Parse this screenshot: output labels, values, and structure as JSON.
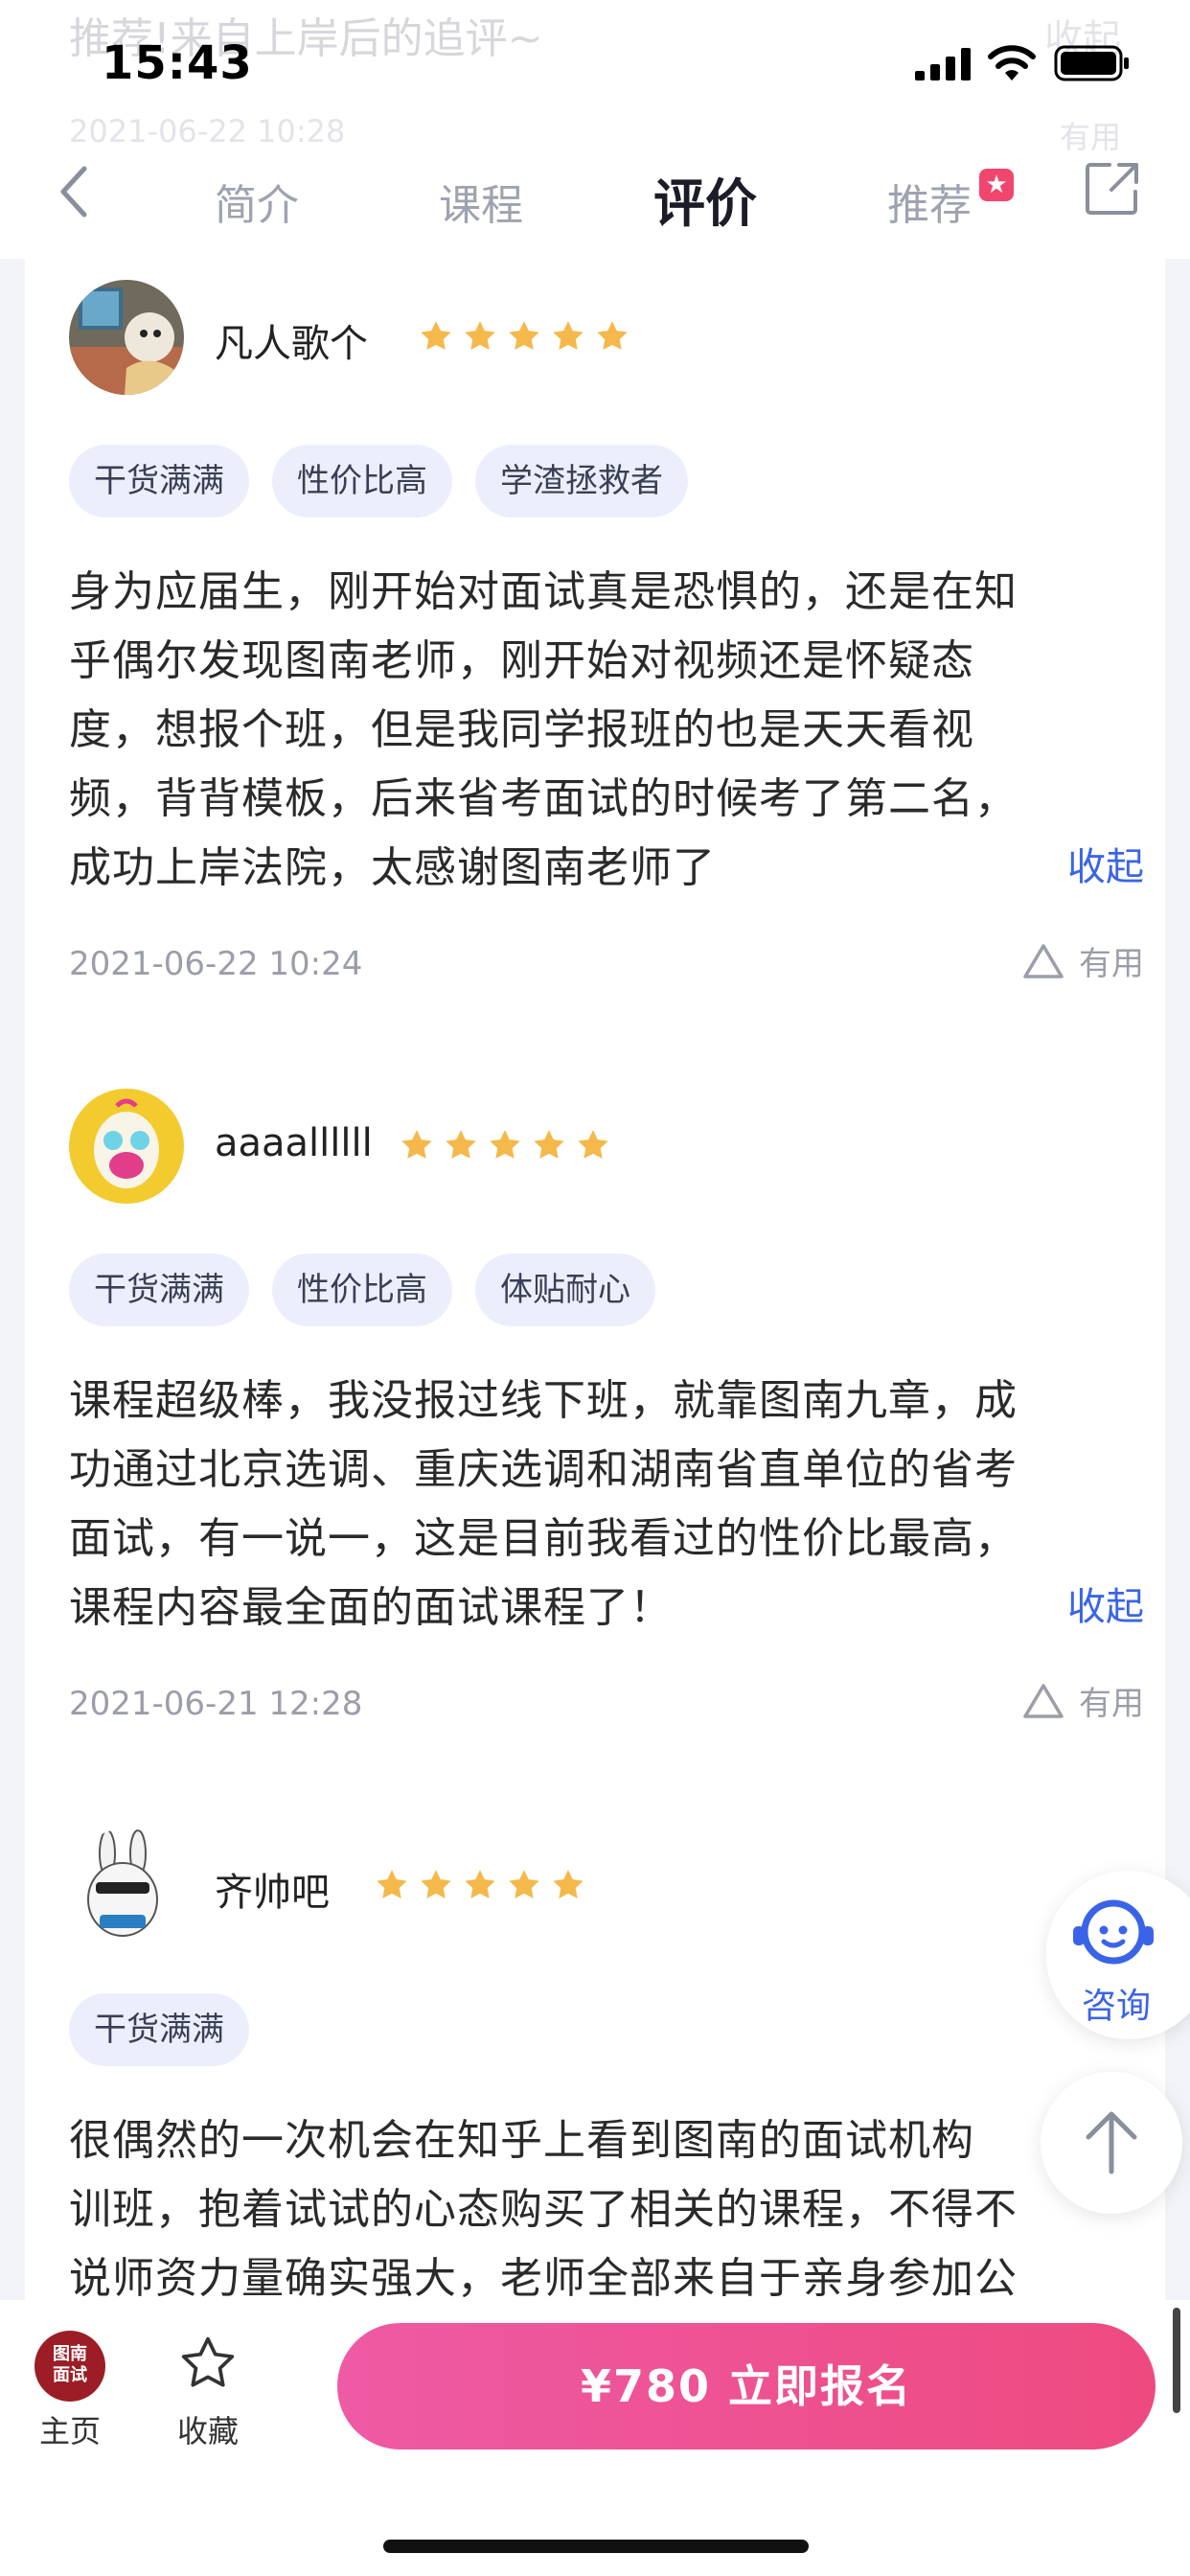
{
  "status_bar": {
    "time": "15:43"
  },
  "ghost": {
    "text": "推荐!来自上岸后的追评~",
    "fold": "收起",
    "date": "2021-06-22 10:28",
    "useful": "有用"
  },
  "nav": {
    "tabs": [
      {
        "label": "简介",
        "active": false
      },
      {
        "label": "课程",
        "active": false
      },
      {
        "label": "评价",
        "active": true
      },
      {
        "label": "推荐",
        "active": false,
        "badge": "★"
      }
    ]
  },
  "reviews": [
    {
      "user": "凡人歌个",
      "stars": 5,
      "tags": [
        "干货满满",
        "性价比高",
        "学渣拯救者"
      ],
      "lines": [
        "身为应届生，刚开始对面试真是恐惧的，还是在知",
        "乎偶尔发现图南老师，刚开始对视频还是怀疑态",
        "度，想报个班，但是我同学报班的也是天天看视",
        "频，背背模板，后来省考面试的时候考了第二名，",
        "成功上岸法院，太感谢图南老师了"
      ],
      "fold": "收起",
      "date": "2021-06-22 10:24",
      "useful": "有用"
    },
    {
      "user": "aaaallllll",
      "stars": 5,
      "tags": [
        "干货满满",
        "性价比高",
        "体贴耐心"
      ],
      "lines": [
        "课程超级棒，我没报过线下班，就靠图南九章，成",
        "功通过北京选调、重庆选调和湖南省直单位的省考",
        "面试，有一说一，这是目前我看过的性价比最高，",
        "课程内容最全面的面试课程了！"
      ],
      "fold": "收起",
      "date": "2021-06-21 12:28",
      "useful": "有用"
    },
    {
      "user": "齐帅吧",
      "stars": 5,
      "tags": [
        "干货满满"
      ],
      "lines": [
        "很偶然的一次机会在知乎上看到图南的面试机构",
        "训班，抱着试试的心态购买了相关的课程，不得不",
        "说师资力量确实强大，老师全部来自于亲身参加公"
      ]
    }
  ],
  "floating": {
    "consult_label": "咨询"
  },
  "bottom_bar": {
    "logo_text_1": "图南",
    "logo_text_2": "面试",
    "home_label": "主页",
    "fav_label": "收藏",
    "enroll_label": "¥780 立即报名"
  },
  "colors": {
    "accent": "#3a64e8",
    "star": "#f5b84a",
    "enroll_gradient_start": "#ee5aa4",
    "enroll_gradient_end": "#ee4a80",
    "tag_bg": "#eceffb"
  }
}
